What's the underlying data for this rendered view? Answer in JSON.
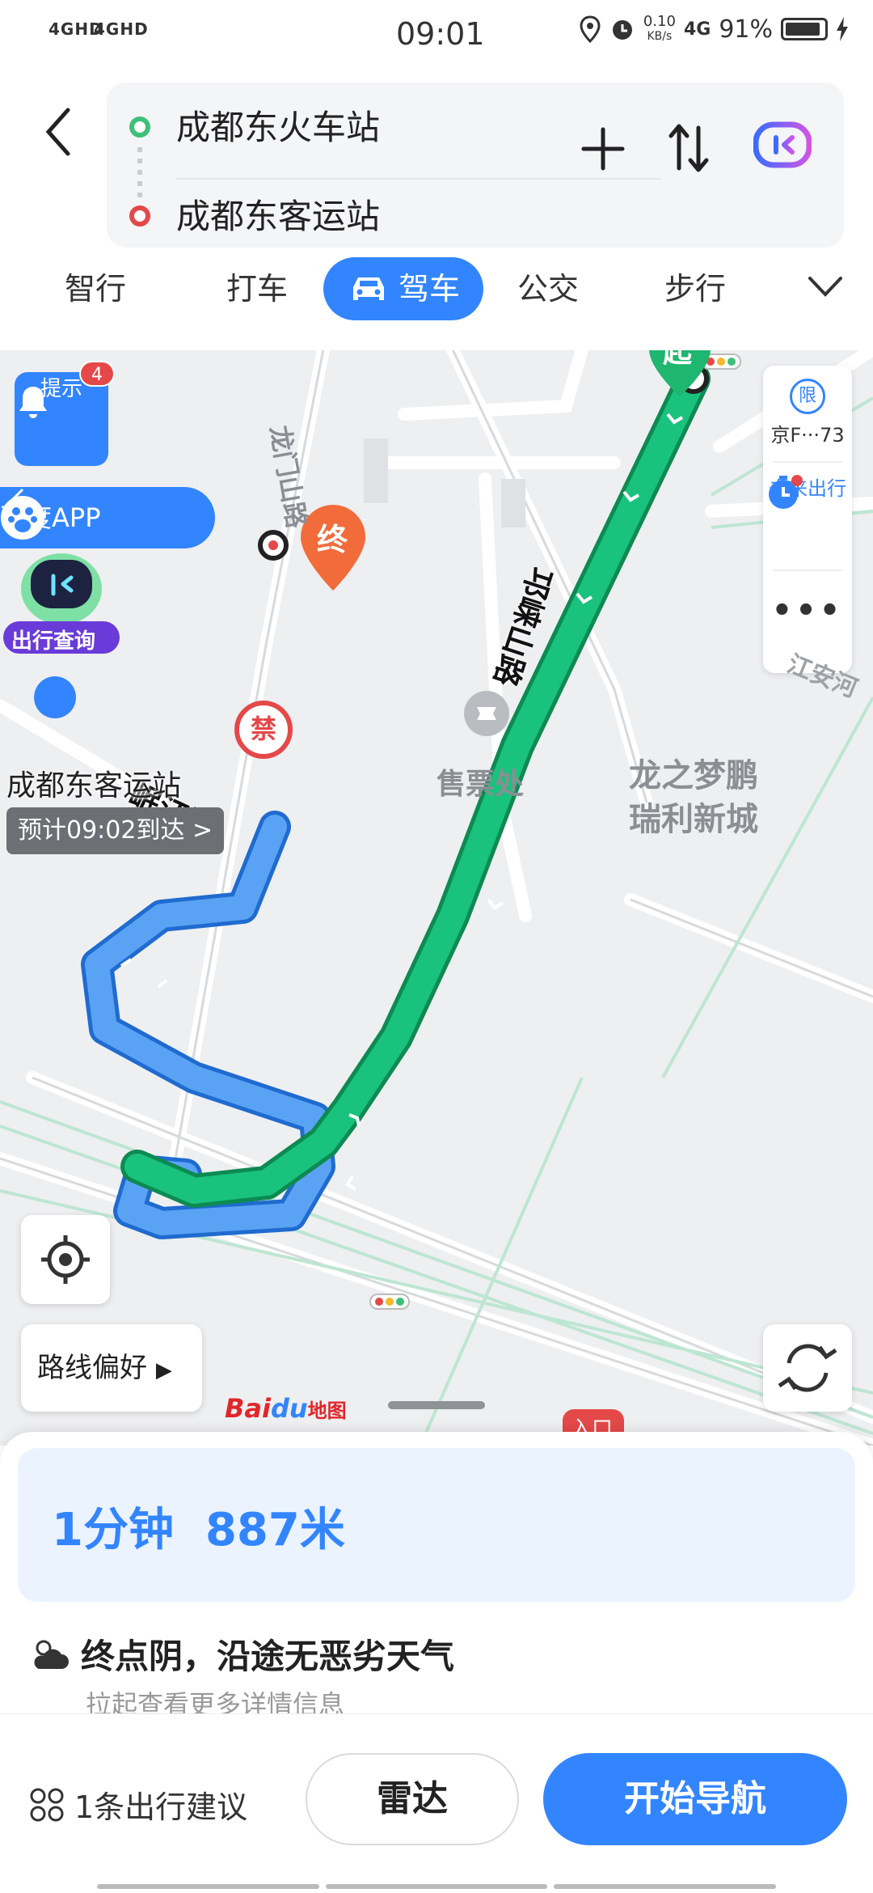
{
  "status_bar": {
    "net1": "4GHD",
    "net2": "4GHD",
    "time": "09:01",
    "speed": "0.10",
    "speed_unit": "KB/s",
    "signal": "4G",
    "battery": "91%"
  },
  "route": {
    "start": "成都东火车站",
    "end": "成都东客运站"
  },
  "tabs": [
    "智行",
    "打车",
    "驾车",
    "公交",
    "步行"
  ],
  "active_tab": "驾车",
  "map": {
    "tip_label": "提示",
    "tip_badge": "4",
    "baidu_app": "百度APP",
    "robot_label": "出行查询",
    "limit_text": "京F···73",
    "limit_icon": "限",
    "future_label": "未来出行",
    "start_marker": "起",
    "end_marker": "终",
    "forbidden": "禁",
    "poi_ticket": "售票处",
    "road_longmen": "龙门山路",
    "road_qionglai": "邛崃山路",
    "road_minjiang": "岷江路",
    "road_jiangan": "江安河",
    "area_name": [
      "龙之梦鹏",
      "瑞利新城"
    ],
    "end_name": "成都东客运站",
    "eta": "预计09:02到达 >",
    "route_pref": "路线偏好",
    "logo": "Bai",
    "logo_du": "du",
    "logo_suffix": "地图",
    "entrance": "入口"
  },
  "summary": {
    "time": "1分钟",
    "distance": "887米"
  },
  "weather": {
    "text": "终点阴，沿途无恶劣天气",
    "sub": "拉起查看更多详情信息"
  },
  "footer": {
    "suggest": "1条出行建议",
    "radar": "雷达",
    "navigate": "开始导航"
  },
  "colors": {
    "accent": "#3385ff",
    "route_green": "#19c27d",
    "route_blue": "#4a98f0",
    "end_marker": "#f26b3a"
  }
}
